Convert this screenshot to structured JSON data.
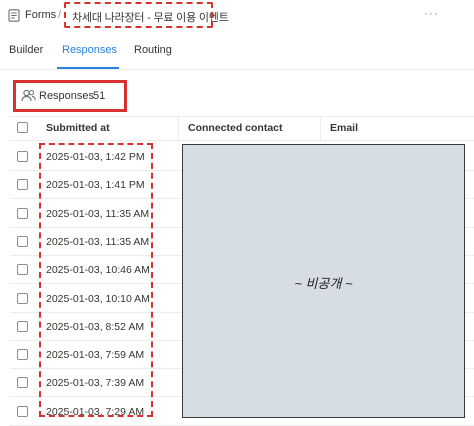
{
  "breadcrumb": {
    "forms_label": "Forms",
    "separator": "/",
    "form_title": "차세대 나라장터 - 무료 이용 이벤트"
  },
  "more_label": "···",
  "tabs": [
    {
      "label": "Builder",
      "active": false
    },
    {
      "label": "Responses",
      "active": true
    },
    {
      "label": "Routing",
      "active": false
    }
  ],
  "responses": {
    "label": "Responses",
    "count": "51"
  },
  "table": {
    "columns": [
      "Submitted at",
      "Connected contact",
      "Email"
    ],
    "rows": [
      "2025-01-03, 1:42 PM",
      "2025-01-03, 1:41 PM",
      "2025-01-03, 11:35 AM",
      "2025-01-03, 11:35 AM",
      "2025-01-03, 10:46 AM",
      "2025-01-03, 10:10 AM",
      "2025-01-03, 8:52 AM",
      "2025-01-03, 7:59 AM",
      "2025-01-03, 7:39 AM",
      "2025-01-03, 7:29 AM"
    ]
  },
  "redaction_label": "~ 비공개 ~",
  "colors": {
    "accent": "#2783de",
    "annotation": "#d9322e",
    "redaction_fill": "#d6dee4"
  }
}
